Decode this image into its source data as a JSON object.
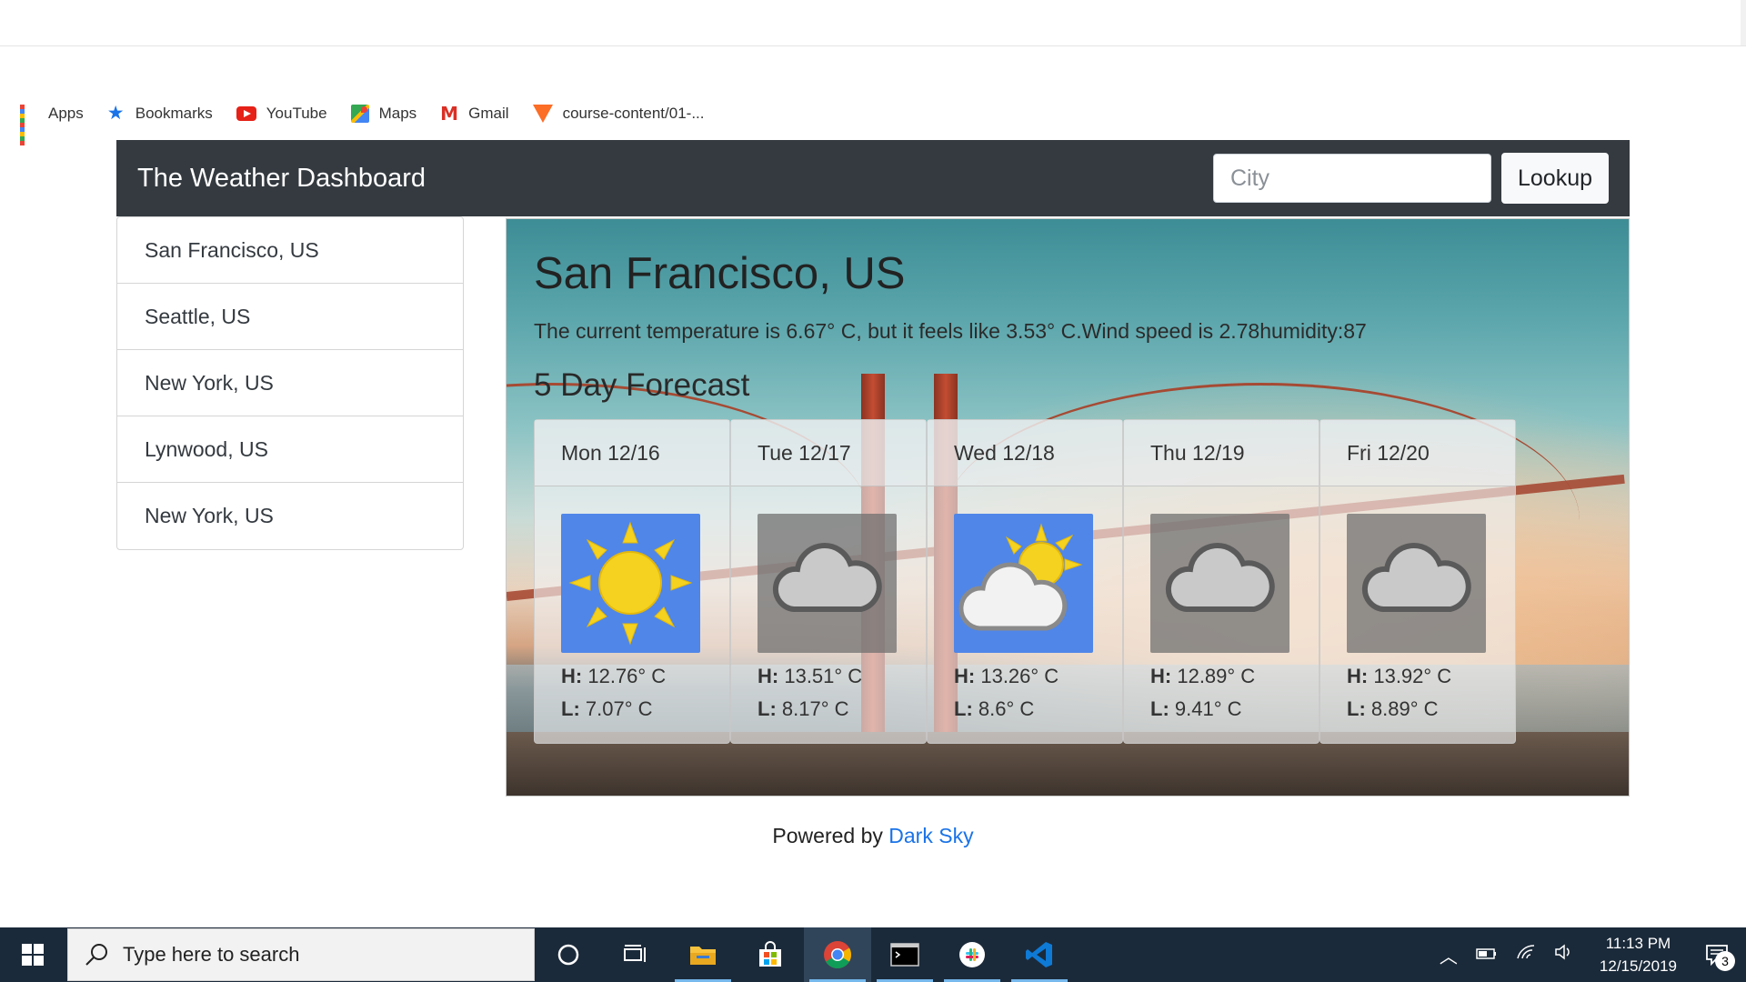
{
  "bookmarks": [
    {
      "label": "Apps",
      "icon": "apps-grid-icon"
    },
    {
      "label": "Bookmarks",
      "icon": "star-icon"
    },
    {
      "label": "YouTube",
      "icon": "youtube-icon"
    },
    {
      "label": "Maps",
      "icon": "maps-icon"
    },
    {
      "label": "Gmail",
      "icon": "gmail-icon"
    },
    {
      "label": "course-content/01-...",
      "icon": "gitlab-icon"
    }
  ],
  "navbar": {
    "brand": "The Weather Dashboard",
    "city_placeholder": "City",
    "city_value": "",
    "lookup_label": "Lookup"
  },
  "history": [
    "San Francisco, US",
    "Seattle, US",
    "New York, US",
    "Lynwood, US",
    "New York, US"
  ],
  "current": {
    "city": "San Francisco, US",
    "summary": "The current temperature is 6.67° C, but it feels like 3.53° C.Wind speed is 2.78humidity:87"
  },
  "forecast": {
    "title": "5 Day Forecast",
    "high_label": "H:",
    "low_label": "L:",
    "days": [
      {
        "date": "Mon 12/16",
        "icon": "clear-day-icon",
        "high": "12.76° C",
        "low": "7.07° C"
      },
      {
        "date": "Tue 12/17",
        "icon": "cloudy-icon",
        "high": "13.51° C",
        "low": "8.17° C"
      },
      {
        "date": "Wed 12/18",
        "icon": "partly-cloudy-day-icon",
        "high": "13.26° C",
        "low": "8.6° C"
      },
      {
        "date": "Thu 12/19",
        "icon": "cloudy-icon",
        "high": "12.89° C",
        "low": "9.41° C"
      },
      {
        "date": "Fri 12/20",
        "icon": "cloudy-icon",
        "high": "13.92° C",
        "low": "8.89° C"
      }
    ]
  },
  "footer": {
    "prefix": "Powered by",
    "link_label": "Dark Sky"
  },
  "taskbar": {
    "search_placeholder": "Type here to search",
    "time": "11:13 PM",
    "date": "12/15/2019",
    "notification_count": "3"
  },
  "colors": {
    "navbar": "#343a40",
    "link": "#1a73e8",
    "icon_sky": "#4f86e8",
    "sun": "#f4d21f"
  }
}
